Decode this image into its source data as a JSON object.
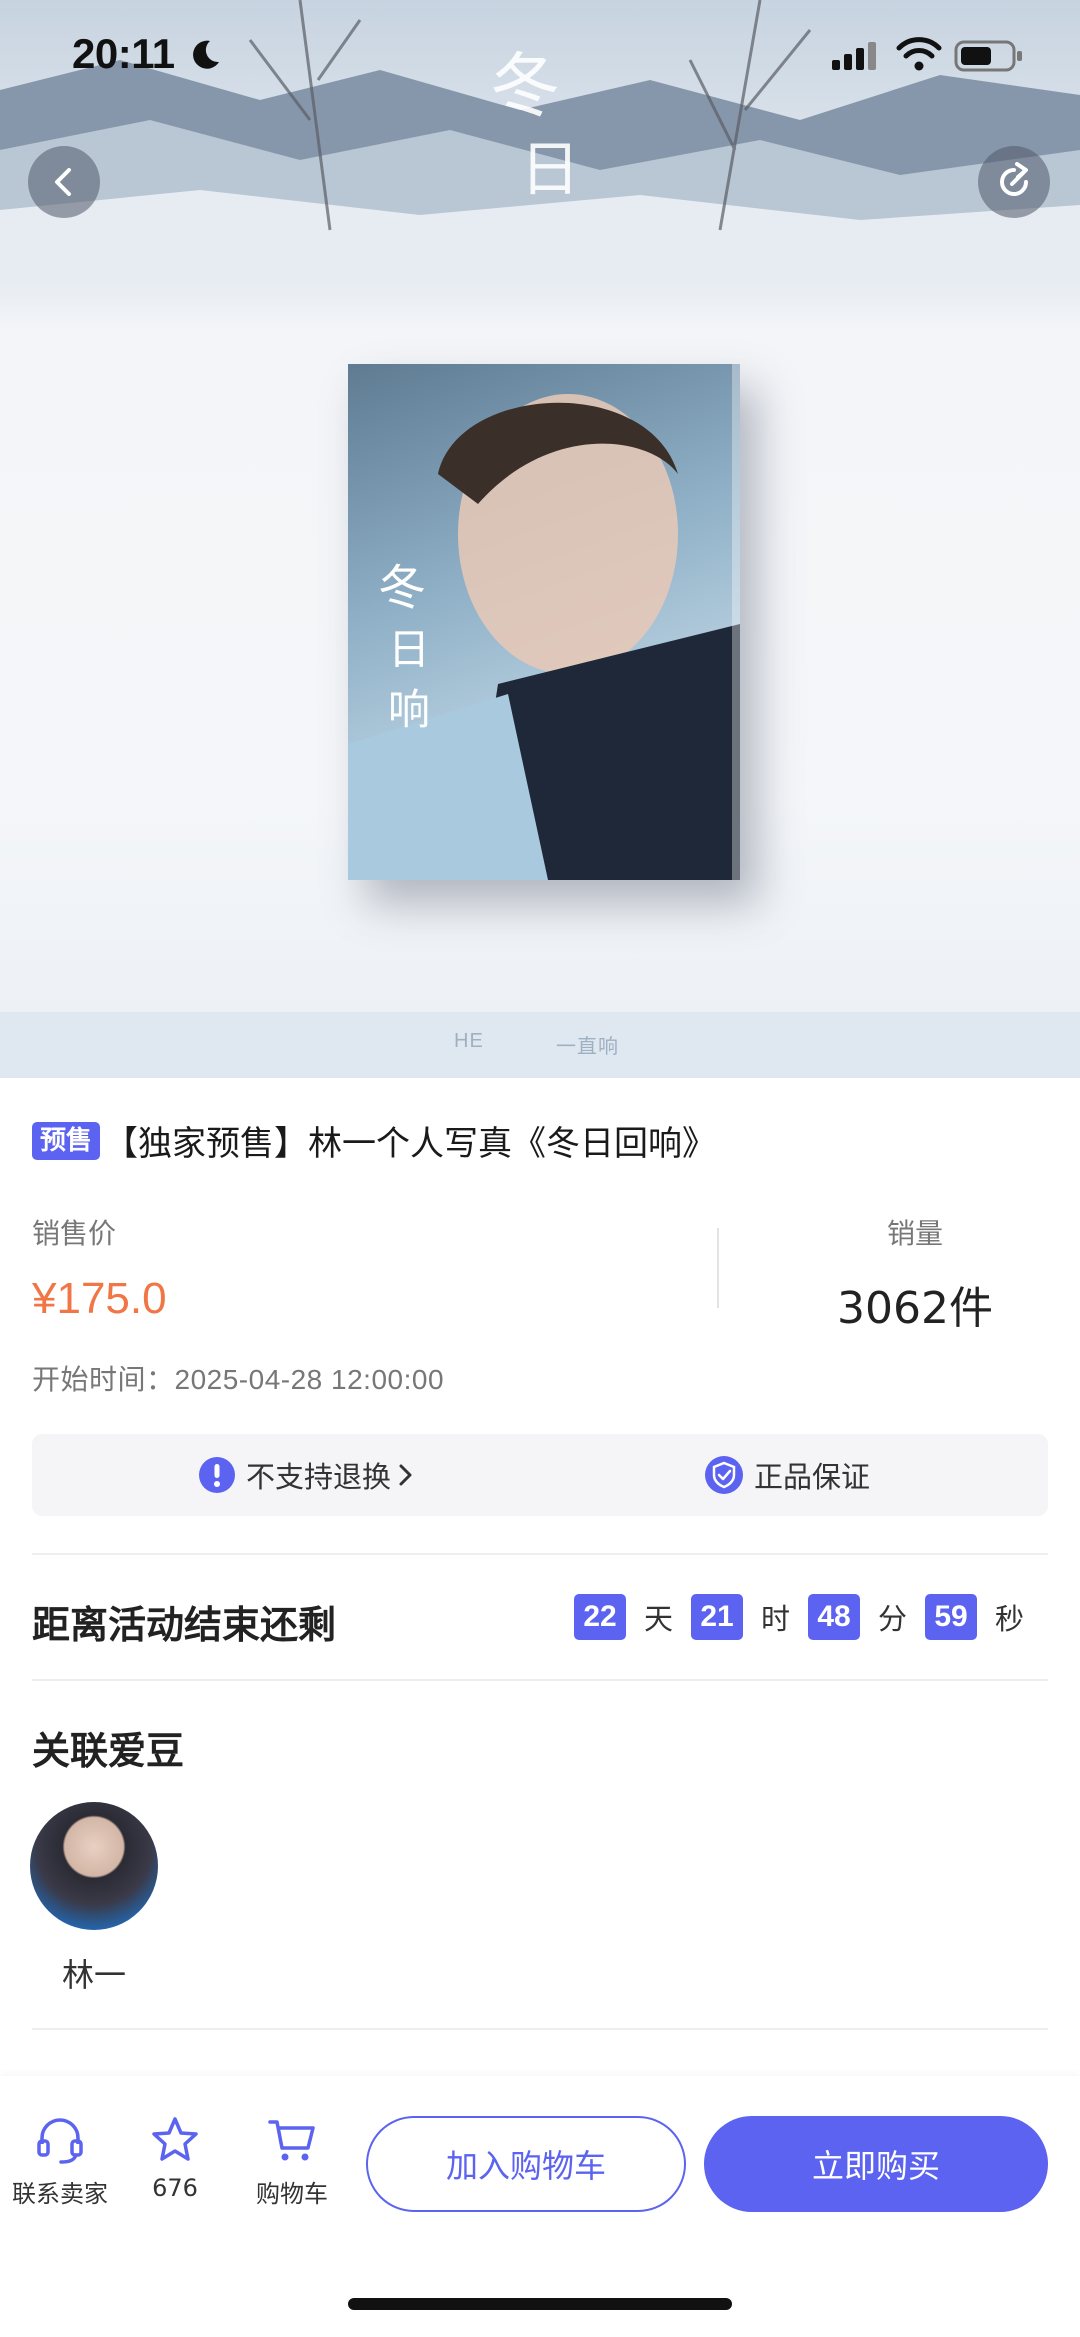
{
  "status_bar": {
    "time": "20:11",
    "icons": [
      "moon-icon",
      "signal-icon",
      "wifi-icon",
      "battery-icon"
    ]
  },
  "hero": {
    "brands": [
      "HE",
      "一直响"
    ]
  },
  "product": {
    "tag": "预售",
    "title": "【独家预售】林一个人写真《冬日回响》",
    "price_label": "销售价",
    "price": "¥175.0",
    "sales_label": "销量",
    "sales_value": "3062件",
    "start_time_label": "开始时间：",
    "start_time_value": "2025-04-28 12:00:00"
  },
  "guarantee": {
    "return_policy": "不支持退换",
    "authentic": "正品保证"
  },
  "countdown": {
    "label": "距离活动结束还剩",
    "days": "22",
    "days_unit": "天",
    "hours": "21",
    "hours_unit": "时",
    "minutes": "48",
    "minutes_unit": "分",
    "seconds": "59",
    "seconds_unit": "秒"
  },
  "idol": {
    "section_title": "关联爱豆",
    "name": "林一"
  },
  "bottom_bar": {
    "contact": "联系卖家",
    "favorites": "676",
    "cart": "购物车",
    "add_to_cart": "加入购物车",
    "buy_now": "立即购买"
  },
  "colors": {
    "accent": "#5b63f0",
    "price": "#f07645"
  }
}
